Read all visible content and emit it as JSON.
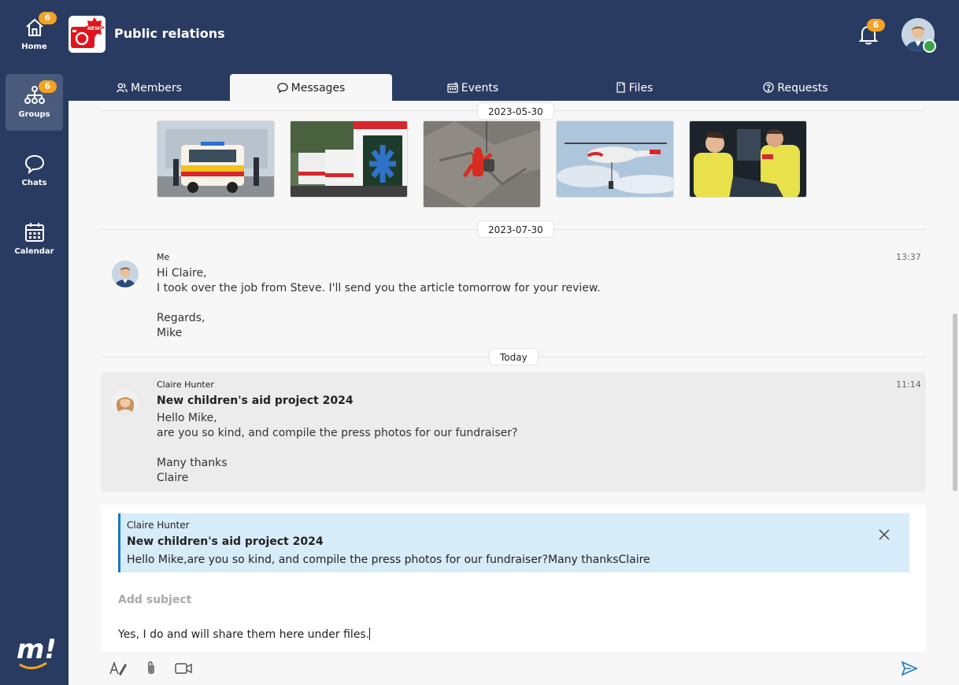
{
  "sidebar": {
    "items": [
      {
        "label": "Home",
        "badge": "6",
        "icon": "home-icon"
      },
      {
        "label": "Groups",
        "badge": "6",
        "icon": "groups-icon",
        "active": true
      },
      {
        "label": "Chats",
        "icon": "chat-icon"
      },
      {
        "label": "Calendar",
        "icon": "calendar-icon"
      }
    ],
    "logo": "m!"
  },
  "header": {
    "title": "Public relations",
    "app_icon_label": "NEWS",
    "notification_badge": "6"
  },
  "tabs": [
    {
      "label": "Members",
      "icon": "members-icon"
    },
    {
      "label": "Messages",
      "icon": "message-icon",
      "active": true
    },
    {
      "label": "Events",
      "icon": "events-icon"
    },
    {
      "label": "Files",
      "icon": "files-icon"
    },
    {
      "label": "Requests",
      "icon": "requests-icon"
    }
  ],
  "messages": {
    "dates": [
      "2023-05-30",
      "2023-07-30",
      "Today"
    ],
    "photos": [
      "ambulance-photo",
      "ambulance-rear-photo",
      "cliff-rescue-photo",
      "helicopter-photo",
      "paramedics-photo"
    ],
    "items": [
      {
        "sender": "Me",
        "time": "13:37",
        "lines": [
          "Hi Claire,",
          "I took over the job from Steve. I'll send you the article tomorrow for your review.",
          "",
          "Regards,",
          "Mike"
        ]
      },
      {
        "sender": "Claire Hunter",
        "time": "11:14",
        "subject": "New children's aid project 2024",
        "lines": [
          "Hello Mike,",
          "are you so kind, and compile the press photos for our fundraiser?",
          "",
          "Many thanks",
          "Claire"
        ]
      }
    ]
  },
  "composer": {
    "quote": {
      "sender": "Claire Hunter",
      "subject": "New children's aid project 2024",
      "text": "Hello Mike,are you so kind, and compile the press photos for our fundraiser?Many thanksClaire"
    },
    "subject_placeholder": "Add subject",
    "body": "Yes, I do and will share them here under files."
  },
  "colors": {
    "sidebar_bg": "#2a3b62",
    "badge": "#f4a223",
    "accent": "#1b78c4",
    "online": "#3aa449"
  }
}
